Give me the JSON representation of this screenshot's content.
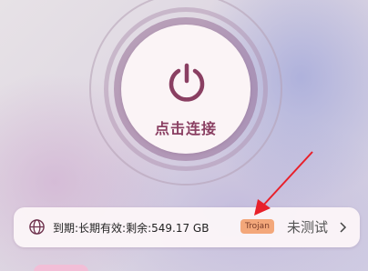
{
  "connect": {
    "label": "点击连接",
    "icon": "power-icon"
  },
  "server": {
    "info": "到期:长期有效:剩余:549.17 GB",
    "protocol": "Trojan",
    "test_status": "未测试",
    "icon": "globe-icon"
  },
  "colors": {
    "accent": "#8a3f62",
    "badge": "#f3a77a",
    "arrow": "#e8202a"
  }
}
